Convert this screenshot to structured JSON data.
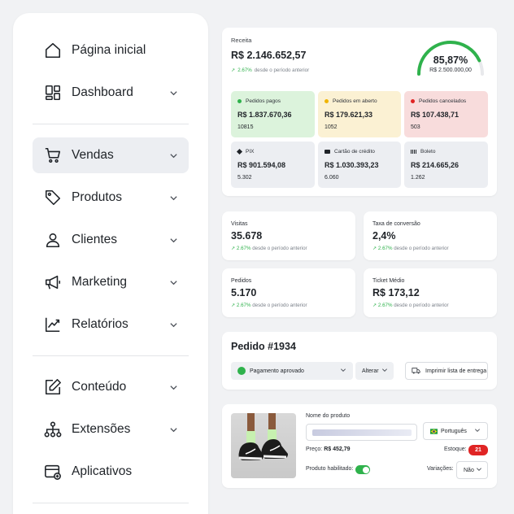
{
  "sidebar": {
    "items": [
      {
        "label": "Página inicial",
        "icon": "home-icon",
        "has_chevron": false
      },
      {
        "label": "Dashboard",
        "icon": "dashboard-icon",
        "has_chevron": true
      },
      {
        "label": "Vendas",
        "icon": "cart-icon",
        "has_chevron": true,
        "active": true
      },
      {
        "label": "Produtos",
        "icon": "tag-icon",
        "has_chevron": true
      },
      {
        "label": "Clientes",
        "icon": "user-icon",
        "has_chevron": true
      },
      {
        "label": "Marketing",
        "icon": "megaphone-icon",
        "has_chevron": true
      },
      {
        "label": "Relatórios",
        "icon": "chart-line-icon",
        "has_chevron": true
      },
      {
        "label": "Conteúdo",
        "icon": "edit-icon",
        "has_chevron": true
      },
      {
        "label": "Extensões",
        "icon": "sitemap-icon",
        "has_chevron": true
      },
      {
        "label": "Aplicativos",
        "icon": "app-add-icon",
        "has_chevron": false
      }
    ]
  },
  "revenue": {
    "label": "Receita",
    "value": "R$ 2.146.652,57",
    "delta": "2.67%",
    "delta_text": "desde o período anterior",
    "goal_percent_text": "85,87%",
    "goal_fraction": 0.8587,
    "goal_value": "R$ 2.500.000,00",
    "tiles": [
      {
        "title": "Pedidos pagos",
        "value": "R$ 1.837.670,36",
        "count": "10815",
        "bg": "#dcf3dc",
        "dot": "#2fb24c",
        "icon": "dot"
      },
      {
        "title": "Pedidos em aberto",
        "value": "R$ 179.621,33",
        "count": "1052",
        "bg": "#fbf1d3",
        "dot": "#f0b400",
        "icon": "dot"
      },
      {
        "title": "Pedidos cancelados",
        "value": "R$ 107.438,71",
        "count": "503",
        "bg": "#f8dcdc",
        "dot": "#e02424",
        "icon": "dot"
      },
      {
        "title": "PIX",
        "value": "R$ 901.594,08",
        "count": "5.302",
        "bg": "#eceef2",
        "icon": "pix-icon"
      },
      {
        "title": "Cartão de crédito",
        "value": "R$ 1.030.393,23",
        "count": "6.060",
        "bg": "#eceef2",
        "icon": "credit-card-icon"
      },
      {
        "title": "Boleto",
        "value": "R$ 214.665,26",
        "count": "1.262",
        "bg": "#eceef2",
        "icon": "barcode-icon"
      }
    ]
  },
  "stats": [
    {
      "title": "Visitas",
      "value": "35.678",
      "delta": "2.67%",
      "delta_text": "desde o período anterior"
    },
    {
      "title": "Taxa de conversão",
      "value": "2,4%",
      "delta": "2.67%",
      "delta_text": "desde o período anterior"
    },
    {
      "title": "Pedidos",
      "value": "5.170",
      "delta": "2.67%",
      "delta_text": "desde o período anterior"
    },
    {
      "title": "Ticket Médio",
      "value": "R$ 173,12",
      "delta": "2.67%",
      "delta_text": "desde o período anterior"
    }
  ],
  "order": {
    "title": "Pedido #1934",
    "status": "Pagamento aprovado",
    "change_label": "Alterar",
    "print_label": "Imprimir lista de entrega"
  },
  "product": {
    "name_label": "Nome do produto",
    "language": "Português",
    "price_label": "Preço:",
    "price": "R$ 452,79",
    "stock_label": "Estoque:",
    "stock": "21",
    "enabled_label": "Produto habilitado:",
    "enabled": true,
    "variations_label": "Variações:",
    "variations_value": "Não"
  },
  "colors": {
    "accent_green": "#2fb24c",
    "danger_red": "#e02424",
    "active_nav": "#eceef2"
  }
}
